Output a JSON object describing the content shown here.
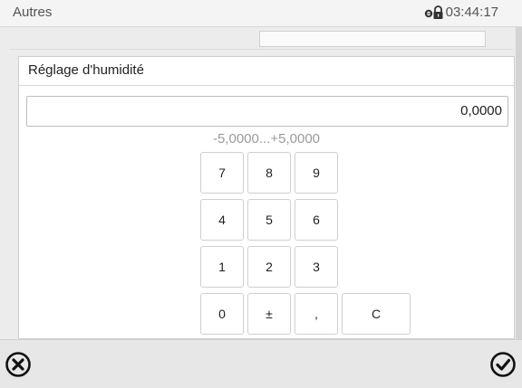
{
  "status_bar": {
    "title": "Autres",
    "time": "03:44:17",
    "lock_icon": "lock-icon"
  },
  "dialog": {
    "title": "Réglage d'humidité",
    "value": "0,0000",
    "range": "-5,0000...+5,0000",
    "keys": {
      "k7": "7",
      "k8": "8",
      "k9": "9",
      "k4": "4",
      "k5": "5",
      "k6": "6",
      "k1": "1",
      "k2": "2",
      "k3": "3",
      "k0": "0",
      "sign": "±",
      "comma": ",",
      "clear": "C"
    }
  },
  "footer": {
    "cancel_icon": "close-circle-icon",
    "confirm_icon": "checkmark-circle-icon"
  },
  "colors": {
    "status_bar_bg": "#f4f4f4",
    "footer_bg": "#e7e7e7",
    "range_text": "#9a9a9a"
  }
}
